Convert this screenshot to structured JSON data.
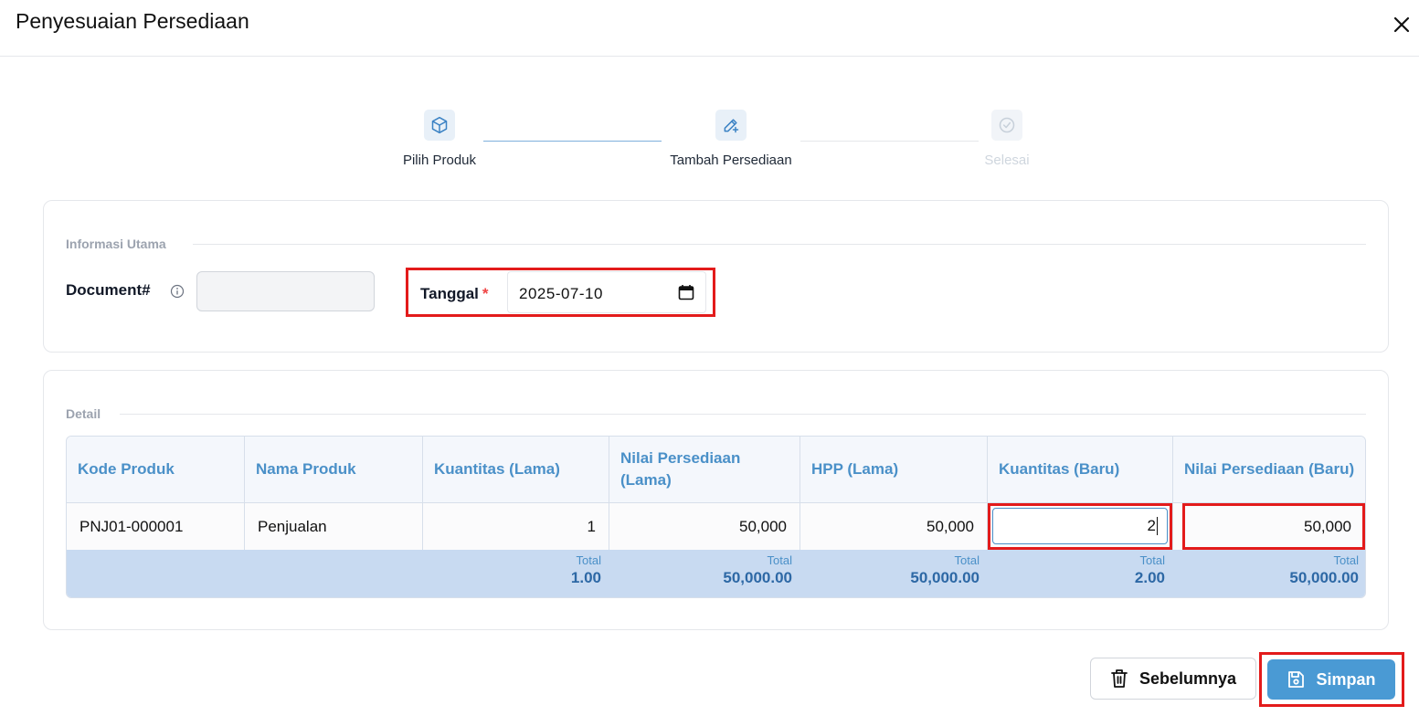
{
  "modal": {
    "title": "Penyesuaian Persediaan"
  },
  "steps": [
    {
      "label": "Pilih Produk",
      "icon": "box-icon",
      "status": "done"
    },
    {
      "label": "Tambah Persediaan",
      "icon": "edit-plus-icon",
      "status": "active"
    },
    {
      "label": "Selesai",
      "icon": "check-circle-icon",
      "status": "pending"
    }
  ],
  "info": {
    "section_title": "Informasi Utama",
    "document_label": "Document#",
    "document_value": "",
    "date_label": "Tanggal",
    "required_mark": "*",
    "date_value": "2025-07-10"
  },
  "detail": {
    "section_title": "Detail",
    "columns": [
      "Kode Produk",
      "Nama Produk",
      "Kuantitas (Lama)",
      "Nilai Persediaan (Lama)",
      "HPP (Lama)",
      "Kuantitas (Baru)",
      "Nilai Persediaan (Baru)"
    ],
    "rows": [
      {
        "kode": "PNJ01-000001",
        "nama": "Penjualan",
        "qty_lama": "1",
        "nilai_lama": "50,000",
        "hpp_lama": "50,000",
        "qty_baru": "2",
        "nilai_baru": "50,000"
      }
    ],
    "totals": {
      "label": "Total",
      "qty_lama": "1.00",
      "nilai_lama": "50,000.00",
      "hpp_lama": "50,000.00",
      "qty_baru": "2.00",
      "nilai_baru": "50,000.00"
    }
  },
  "buttons": {
    "previous": "Sebelumnya",
    "save": "Simpan"
  },
  "colors": {
    "accent": "#4a9ad4",
    "highlight": "#e31b1b",
    "header_text": "#4a90c8",
    "total_bg": "#c8daf1"
  }
}
